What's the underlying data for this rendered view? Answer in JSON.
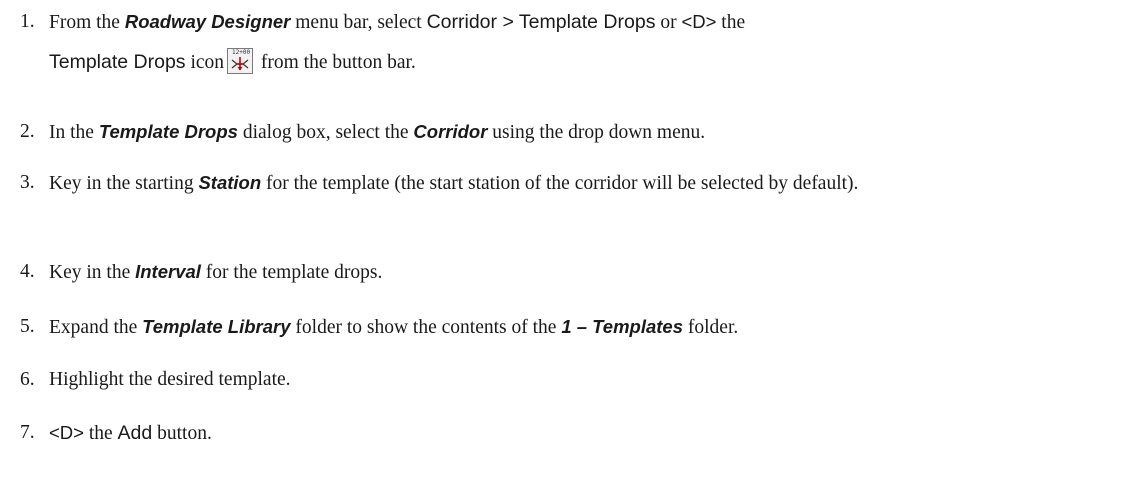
{
  "steps": [
    {
      "number": "1.",
      "line1": [
        {
          "text": "From the ",
          "style": "plain"
        },
        {
          "text": "Roadway Designer",
          "style": "bi"
        },
        {
          "text": " menu bar, select ",
          "style": "plain"
        },
        {
          "text": "Corridor > Template Drops",
          "style": "ui"
        },
        {
          "text": " or ",
          "style": "plain"
        },
        {
          "text": "<D>",
          "style": "key"
        },
        {
          "text": " the",
          "style": "plain"
        }
      ],
      "line2": [
        {
          "text": "Template Drops",
          "style": "ui"
        },
        {
          "text": " icon",
          "style": "plain"
        },
        {
          "text": " from the button bar.",
          "style": "plain"
        }
      ],
      "icon_label": "12+00",
      "icon_name": "template-drops-icon"
    },
    {
      "number": "2.",
      "segments": [
        {
          "text": "In the ",
          "style": "plain"
        },
        {
          "text": "Template Drops",
          "style": "bi"
        },
        {
          "text": " dialog box, select the ",
          "style": "plain"
        },
        {
          "text": "Corridor",
          "style": "bi"
        },
        {
          "text": " using the drop down menu.",
          "style": "plain"
        }
      ]
    },
    {
      "number": "3.",
      "segments": [
        {
          "text": "Key in the starting ",
          "style": "plain"
        },
        {
          "text": "Station",
          "style": "bi"
        },
        {
          "text": " for the template (the start station of the corridor will be selected by default).",
          "style": "plain"
        }
      ]
    },
    {
      "number": "4.",
      "segments": [
        {
          "text": "Key in the ",
          "style": "plain"
        },
        {
          "text": "Interval",
          "style": "bi"
        },
        {
          "text": " for the template drops.",
          "style": "plain"
        }
      ]
    },
    {
      "number": "5.",
      "segments": [
        {
          "text": "Expand the ",
          "style": "plain"
        },
        {
          "text": "Template Library",
          "style": "bi"
        },
        {
          "text": " folder to show the contents of the ",
          "style": "plain"
        },
        {
          "text": "1 – Templates",
          "style": "bi"
        },
        {
          "text": " folder.",
          "style": "plain"
        }
      ]
    },
    {
      "number": "6.",
      "segments": [
        {
          "text": "Highlight the desired template.",
          "style": "plain"
        }
      ]
    },
    {
      "number": "7.",
      "segments": [
        {
          "text": "<D>",
          "style": "key"
        },
        {
          "text": " the ",
          "style": "plain"
        },
        {
          "text": "Add",
          "style": "ui"
        },
        {
          "text": " button.",
          "style": "plain"
        }
      ]
    }
  ]
}
